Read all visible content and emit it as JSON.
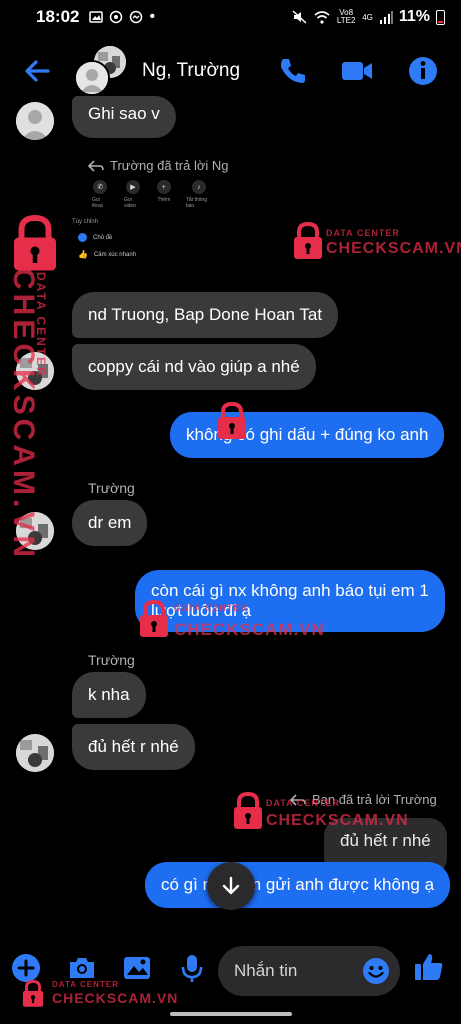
{
  "status_bar": {
    "time": "18:02",
    "network_label": "Vo8 LTE2",
    "network_gen": "4G",
    "battery": "11%"
  },
  "header": {
    "name": "Ng, Trường"
  },
  "messages": {
    "m0": "Ghi sao v",
    "reply_note_1": "Trường đã trả lời Ng",
    "m1": "nd Truong, Bap Done Hoan Tat",
    "m2": "coppy cái nd vào giúp a nhé",
    "m3": "không có ghi dấu + đúng ko anh",
    "sender_1": "Trường",
    "m4": "dr em",
    "m5_line1": "còn cái gì nx không anh báo tụi em 1",
    "m5_line2": "lượt luôn đi ạ",
    "sender_2": "Trường",
    "m6": "k nha",
    "m7": "đủ hết r nhé",
    "reply_note_2": "Bạn đã trả lời Trường",
    "m8_quoted": "đủ hết r nhé",
    "m9": "có gì nữa em gửi anh được không ạ"
  },
  "quoted_card": {
    "actions": [
      "Gọi thoại",
      "Gọi video",
      "Thêm",
      "Tắt thông báo"
    ],
    "section_label": "Tùy chỉnh",
    "options": [
      "Chủ đề",
      "Cảm xúc nhanh"
    ]
  },
  "watermark": {
    "top_text": "DATA CENTER",
    "brand": "CHECKSCAM.VN"
  },
  "composer": {
    "placeholder": "Nhắn tin"
  },
  "colors": {
    "accent": "#2f7bf5",
    "outgoing_bubble": "#1e6ef2",
    "incoming_bubble": "#3a3a3c",
    "watermark": "#e62d49"
  }
}
